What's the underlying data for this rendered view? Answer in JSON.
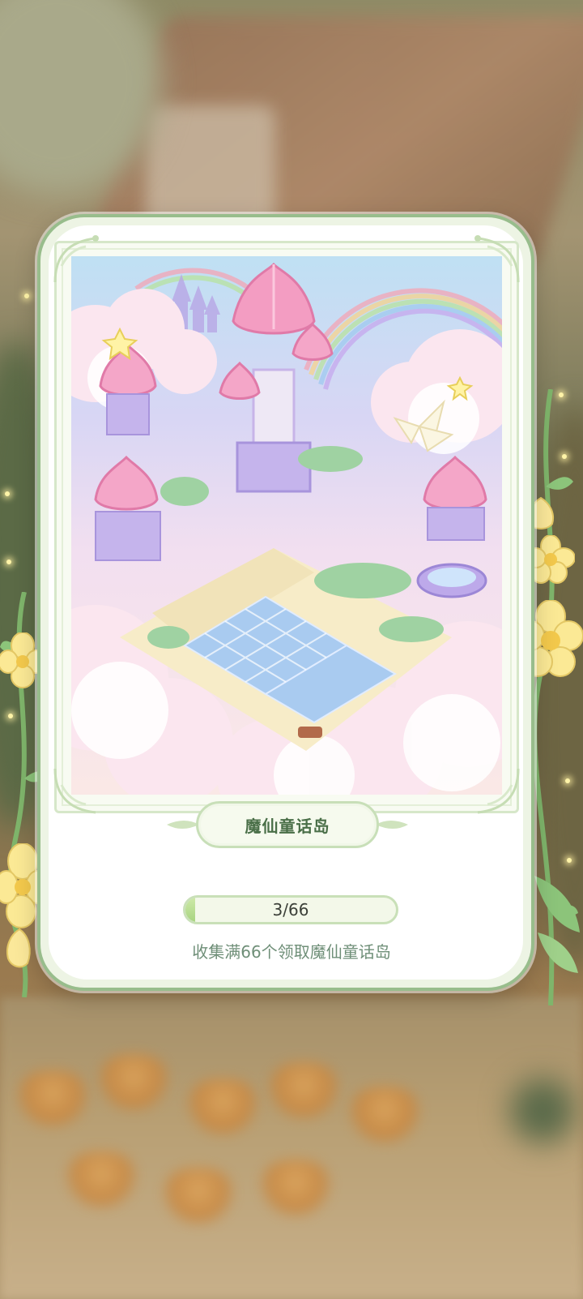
{
  "reward": {
    "name": "魔仙童话岛",
    "progress_text": "3/66",
    "progress_value": 3,
    "progress_max": 66,
    "hint": "收集满66个领取魔仙童话岛"
  },
  "colors": {
    "card_border": "#98bd8c",
    "title_text": "#4a6f48",
    "hint_text": "#6f8f78",
    "progress_fill": "#a8d481"
  },
  "icons": [
    "lotus-tower-illustration",
    "rainbow",
    "yellow-flower-icon",
    "vine"
  ]
}
